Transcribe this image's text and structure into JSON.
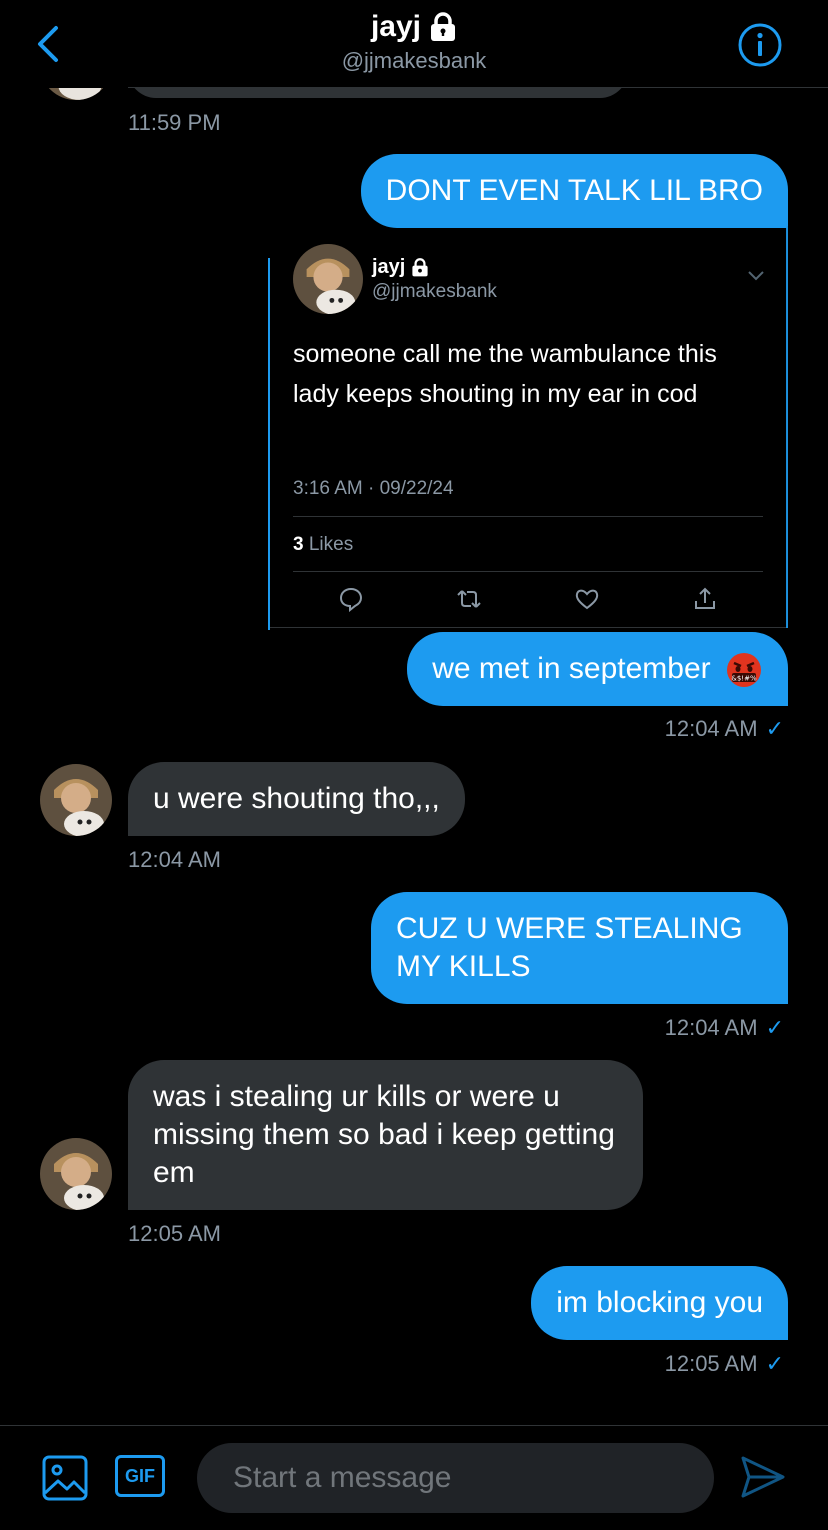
{
  "header": {
    "name": "jayj",
    "handle": "@jjmakesbank",
    "accent": "#1d9bf0"
  },
  "messages": {
    "m0_time": "11:59 PM",
    "m1_text": "DONT EVEN TALK LIL BRO",
    "tweet": {
      "name": "jayj",
      "handle": "@jjmakesbank",
      "text": "someone call me the wambulance this lady keeps shouting in my ear in cod",
      "time": "3:16 AM · 09/22/24",
      "likes_count": "3",
      "likes_label": "Likes"
    },
    "m2_text": "we met in september",
    "m2_emoji": "angry-cursing-face",
    "m2_time": "12:04 AM",
    "m3_text": "u were shouting tho,,,",
    "m3_time": "12:04 AM",
    "m4_text": "CUZ U WERE STEALING MY KILLS",
    "m4_time": "12:04 AM",
    "m5_text": "was i stealing ur kills or were u missing them so bad i keep getting em",
    "m5_time": "12:05 AM",
    "m6_text": "im blocking you",
    "m6_time": "12:05 AM"
  },
  "composer": {
    "placeholder": "Start a message",
    "gif_label": "GIF"
  },
  "colors": {
    "sent_bubble": "#1d9bf0",
    "received_bubble": "#2f3336",
    "background": "#000000"
  }
}
